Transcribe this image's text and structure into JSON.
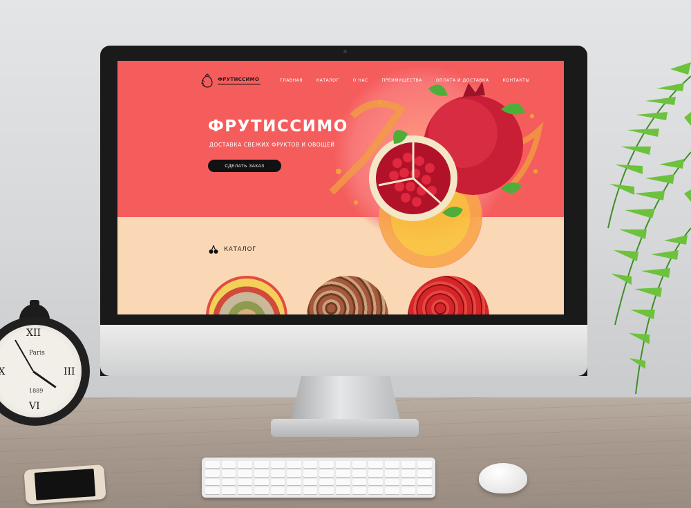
{
  "site": {
    "logo": {
      "name": "ФРУТИССИМО"
    },
    "nav": [
      {
        "label": "ГЛАВНАЯ"
      },
      {
        "label": "КАТАЛОГ"
      },
      {
        "label": "О НАС"
      },
      {
        "label": "ПРЕИМУЩЕСТВА"
      },
      {
        "label": "ОПЛАТА И ДОСТАВКА"
      },
      {
        "label": "КОНТАКТЫ"
      }
    ],
    "hero": {
      "title": "ФРУТИССИМО",
      "subtitle": "ДОСТАВКА СВЕЖИХ ФРУКТОВ И ОВОЩЕЙ",
      "cta_label": "СДЕЛАТЬ ЗАКАЗ"
    },
    "catalog": {
      "heading": "КАТАЛОГ",
      "icon": "cherries-icon",
      "items": [
        {
          "image": "fruit-basket-image"
        },
        {
          "image": "hazelnuts-image"
        },
        {
          "image": "strawberries-image"
        }
      ]
    },
    "colors": {
      "hero_bg": "#f55d5d",
      "section_bg": "#fbd8b5",
      "button_bg": "#111111",
      "text_light": "#ffffff"
    }
  },
  "clock": {
    "brand": "Paris",
    "year": "1889",
    "numerals": [
      "XII",
      "III",
      "VI",
      "IX"
    ]
  }
}
